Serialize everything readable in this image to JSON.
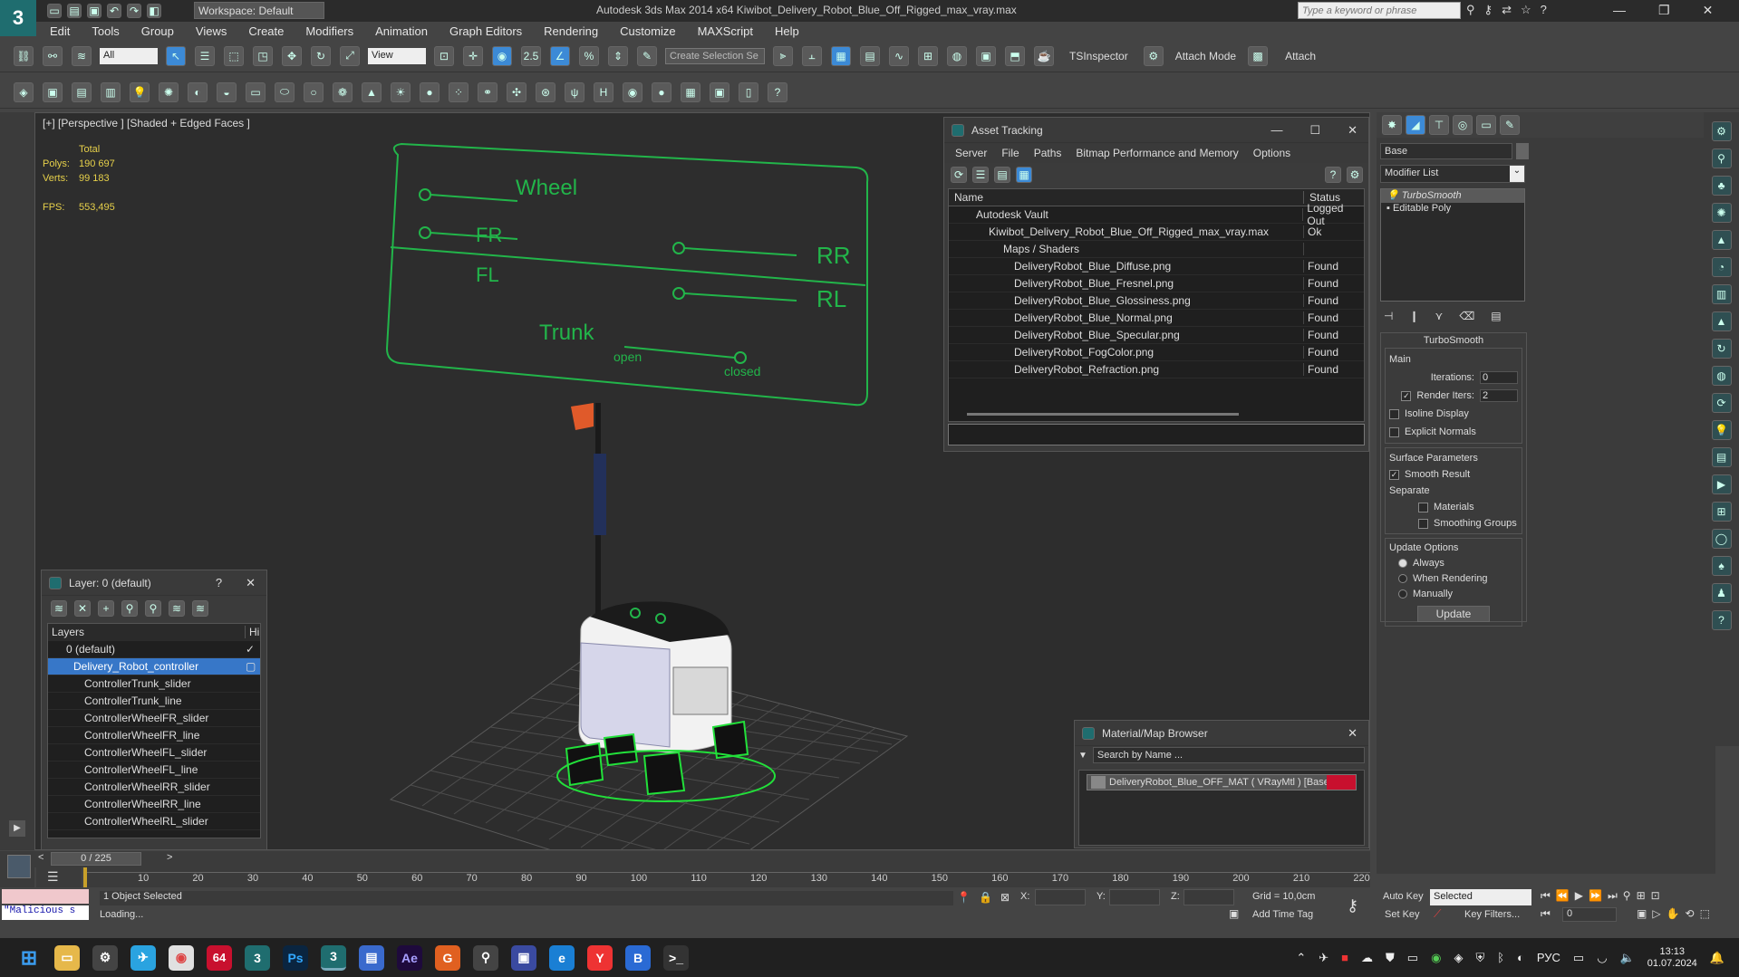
{
  "app": {
    "title": "Autodesk 3ds Max  2014 x64     Kiwibot_Delivery_Robot_Blue_Off_Rigged_max_vray.max",
    "workspace": "Workspace: Default",
    "search_placeholder": "Type a keyword or phrase"
  },
  "menu": [
    "Edit",
    "Tools",
    "Group",
    "Views",
    "Create",
    "Modifiers",
    "Animation",
    "Graph Editors",
    "Rendering",
    "Customize",
    "MAXScript",
    "Help"
  ],
  "toolbar": {
    "filter": "All",
    "view": "View",
    "selection_set": "Create Selection Se",
    "tsinspector": "TSInspector",
    "attach_mode": "Attach Mode",
    "attach": "Attach"
  },
  "viewport": {
    "label": "[+] [Perspective ] [Shaded + Edged Faces ]",
    "stats_total": "Total",
    "polys_label": "Polys:",
    "polys_value": "190 697",
    "verts_label": "Verts:",
    "verts_value": "99 183",
    "fps_label": "FPS:",
    "fps_value": "553,495",
    "rig": {
      "wheel": "Wheel",
      "fr": "FR",
      "fl": "FL",
      "rr": "RR",
      "rl": "RL",
      "trunk": "Trunk",
      "open": "open",
      "closed": "closed"
    }
  },
  "asset_tracking": {
    "title": "Asset Tracking",
    "menu": [
      "Server",
      "File",
      "Paths",
      "Bitmap Performance and Memory",
      "Options"
    ],
    "col_name": "Name",
    "col_status": "Status",
    "rows": [
      {
        "name": "Autodesk Vault",
        "status": "Logged Out"
      },
      {
        "name": "Kiwibot_Delivery_Robot_Blue_Off_Rigged_max_vray.max",
        "status": "Ok"
      },
      {
        "name": "Maps / Shaders",
        "status": ""
      },
      {
        "name": "DeliveryRobot_Blue_Diffuse.png",
        "status": "Found"
      },
      {
        "name": "DeliveryRobot_Blue_Fresnel.png",
        "status": "Found"
      },
      {
        "name": "DeliveryRobot_Blue_Glossiness.png",
        "status": "Found"
      },
      {
        "name": "DeliveryRobot_Blue_Normal.png",
        "status": "Found"
      },
      {
        "name": "DeliveryRobot_Blue_Specular.png",
        "status": "Found"
      },
      {
        "name": "DeliveryRobot_FogColor.png",
        "status": "Found"
      },
      {
        "name": "DeliveryRobot_Refraction.png",
        "status": "Found"
      }
    ]
  },
  "layer_window": {
    "title": "Layer: 0 (default)",
    "col_layers": "Layers",
    "col_hide": "Hi",
    "rows": [
      "0 (default)",
      "Delivery_Robot_controller",
      "ControllerTrunk_slider",
      "ControllerTrunk_line",
      "ControllerWheelFR_slider",
      "ControllerWheelFR_line",
      "ControllerWheelFL_slider",
      "ControllerWheelFL_line",
      "ControllerWheelRR_slider",
      "ControllerWheelRR_line",
      "ControllerWheelRL_slider"
    ]
  },
  "material_browser": {
    "title": "Material/Map Browser",
    "search_placeholder": "Search by Name ...",
    "item": "DeliveryRobot_Blue_OFF_MAT ( VRayMtl ) [Base..."
  },
  "command_panel": {
    "object_name": "Base",
    "modifier_list": "Modifier List",
    "stack": [
      "TurboSmooth",
      "Editable Poly"
    ],
    "rollout_title": "TurboSmooth",
    "main": "Main",
    "iterations_label": "Iterations:",
    "iterations_value": "0",
    "render_iters_label": "Render Iters:",
    "render_iters_value": "2",
    "isoline": "Isoline Display",
    "explicit_normals": "Explicit Normals",
    "surface_params": "Surface Parameters",
    "smooth_result": "Smooth Result",
    "separate": "Separate",
    "materials": "Materials",
    "smoothing_groups": "Smoothing Groups",
    "update_options": "Update Options",
    "always": "Always",
    "when_rendering": "When Rendering",
    "manually": "Manually",
    "update_button": "Update"
  },
  "timeline": {
    "frame": "0 / 225",
    "ticks": [
      "10",
      "20",
      "30",
      "40",
      "50",
      "60",
      "70",
      "80",
      "90",
      "100",
      "110",
      "120",
      "130",
      "140",
      "150",
      "160",
      "170",
      "180",
      "190",
      "200",
      "210",
      "220"
    ]
  },
  "status": {
    "selected": "1 Object Selected",
    "loading": "Loading...",
    "script": "\"Malicious s",
    "x_label": "X:",
    "y_label": "Y:",
    "z_label": "Z:",
    "grid": "Grid = 10,0cm",
    "add_time_tag": "Add Time Tag",
    "auto_key": "Auto Key",
    "set_key": "Set Key",
    "key_mode": "Selected",
    "key_filters": "Key Filters...",
    "frame_value": "0"
  },
  "taskbar": {
    "lang": "РУС",
    "time": "13:13",
    "date": "01.07.2024",
    "badge": "64"
  }
}
